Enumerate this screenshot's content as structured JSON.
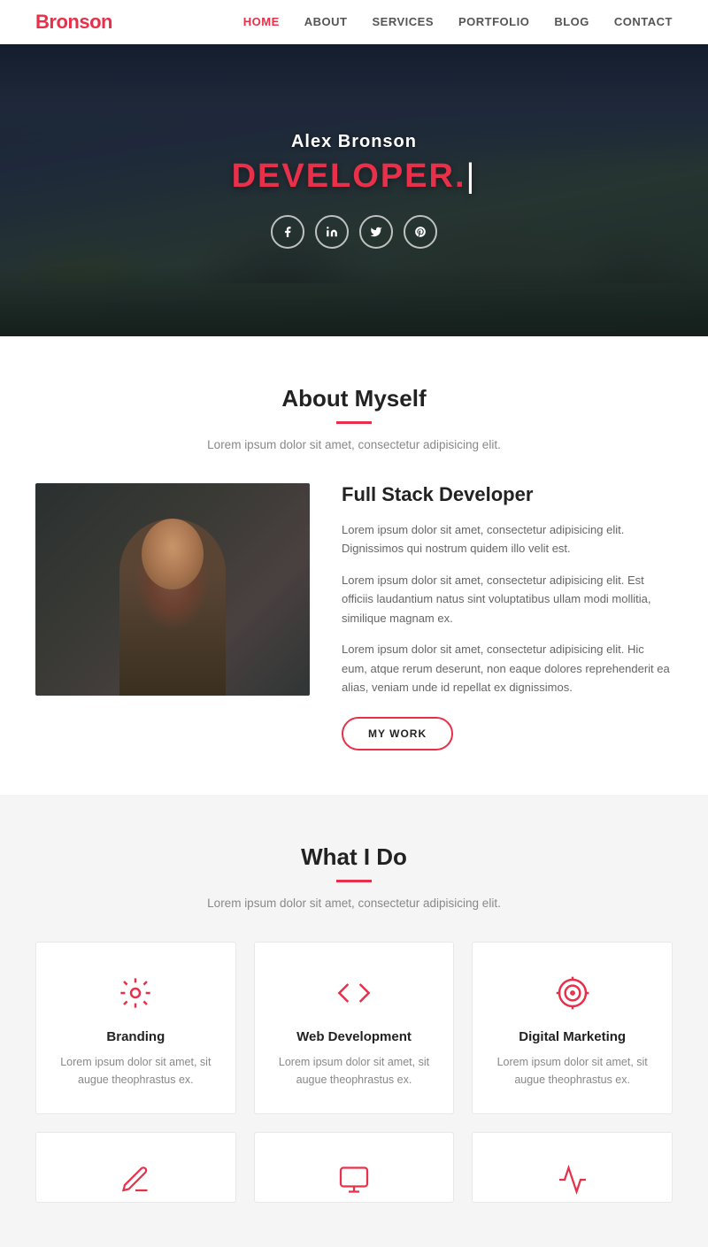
{
  "site": {
    "logo_prefix": "B",
    "logo_text": "ronson"
  },
  "nav": {
    "links": [
      {
        "label": "HOME",
        "active": true
      },
      {
        "label": "ABOUT",
        "active": false
      },
      {
        "label": "SERVICES",
        "active": false
      },
      {
        "label": "PORTFOLIO",
        "active": false
      },
      {
        "label": "BLOG",
        "active": false
      },
      {
        "label": "CONTACT",
        "active": false
      }
    ]
  },
  "hero": {
    "name": "Alex Bronson",
    "title": "DEVELOPER.",
    "social": [
      {
        "icon": "facebook-icon",
        "symbol": "f"
      },
      {
        "icon": "linkedin-icon",
        "symbol": "in"
      },
      {
        "icon": "twitter-icon",
        "symbol": "t"
      },
      {
        "icon": "pinterest-icon",
        "symbol": "p"
      }
    ]
  },
  "about": {
    "section_title": "About Myself",
    "section_subtitle": "Lorem ipsum dolor sit amet, consectetur adipisicing elit.",
    "job_title": "Full Stack Developer",
    "paragraphs": [
      "Lorem ipsum dolor sit amet, consectetur adipisicing elit. Dignissimos qui nostrum quidem illo velit est.",
      "Lorem ipsum dolor sit amet, consectetur adipisicing elit. Est officiis laudantium natus sint voluptatibus ullam modi mollitia, similique magnam ex.",
      "Lorem ipsum dolor sit amet, consectetur adipisicing elit. Hic eum, atque rerum deserunt, non eaque dolores reprehenderit ea alias, veniam unde id repellat ex dignissimos."
    ],
    "btn_label": "MY WORK"
  },
  "services": {
    "section_title": "What I Do",
    "section_subtitle": "Lorem ipsum dolor sit amet, consectetur adipisicing elit.",
    "cards": [
      {
        "id": "branding",
        "title": "Branding",
        "description": "Lorem ipsum dolor sit amet, sit augue theophrastus ex."
      },
      {
        "id": "web-development",
        "title": "Web Development",
        "description": "Lorem ipsum dolor sit amet, sit augue theophrastus ex."
      },
      {
        "id": "digital-marketing",
        "title": "Digital Marketing",
        "description": "Lorem ipsum dolor sit amet, sit augue theophrastus ex."
      }
    ],
    "cards_row2": [
      {
        "id": "design",
        "title": ""
      },
      {
        "id": "code",
        "title": ""
      },
      {
        "id": "analytics",
        "title": ""
      }
    ]
  },
  "colors": {
    "accent": "#e8304a",
    "text_dark": "#222222",
    "text_muted": "#888888",
    "bg_light": "#f5f5f5"
  }
}
